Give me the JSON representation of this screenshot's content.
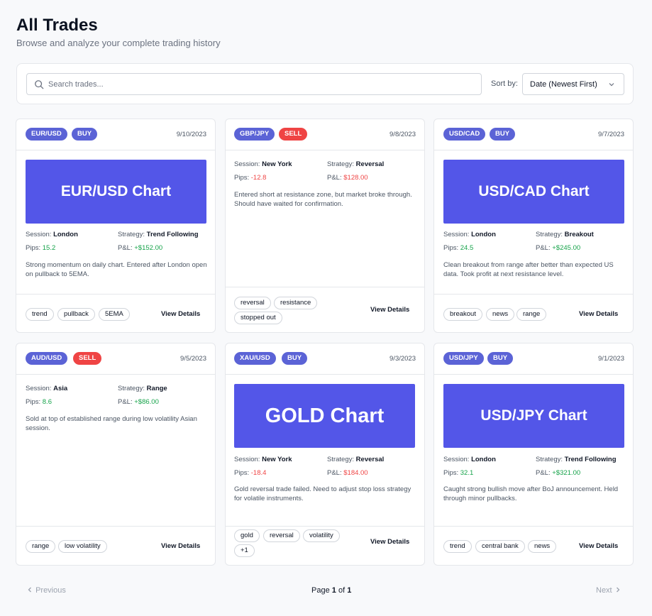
{
  "header": {
    "title": "All Trades",
    "subtitle": "Browse and analyze your complete trading history"
  },
  "filters": {
    "search_placeholder": "Search trades...",
    "sort_label": "Sort by:",
    "sort_value": "Date (Newest First)"
  },
  "labels": {
    "session": "Session:",
    "strategy": "Strategy:",
    "pips": "Pips:",
    "pnl": "P&L:",
    "view_details": "View Details"
  },
  "trades": [
    {
      "pair": "EUR/USD",
      "side": "BUY",
      "date": "9/10/2023",
      "chart_label": "EUR/USD Chart",
      "session": "London",
      "strategy": "Trend Following",
      "pips": "15.2",
      "pnl": "+$152.00",
      "note": "Strong momentum on daily chart. Entered after London open on pullback to 5EMA.",
      "tags": [
        "trend",
        "pullback",
        "5EMA"
      ]
    },
    {
      "pair": "GBP/JPY",
      "side": "SELL",
      "date": "9/8/2023",
      "session": "New York",
      "strategy": "Reversal",
      "pips": "-12.8",
      "pnl": "$128.00",
      "note": "Entered short at resistance zone, but market broke through. Should have waited for confirmation.",
      "tags": [
        "reversal",
        "resistance",
        "stopped out"
      ]
    },
    {
      "pair": "USD/CAD",
      "side": "BUY",
      "date": "9/7/2023",
      "chart_label": "USD/CAD Chart",
      "session": "London",
      "strategy": "Breakout",
      "pips": "24.5",
      "pnl": "+$245.00",
      "note": "Clean breakout from range after better than expected US data. Took profit at next resistance level.",
      "tags": [
        "breakout",
        "news",
        "range"
      ]
    },
    {
      "pair": "AUD/USD",
      "side": "SELL",
      "date": "9/5/2023",
      "session": "Asia",
      "strategy": "Range",
      "pips": "8.6",
      "pnl": "+$86.00",
      "note": "Sold at top of established range during low volatility Asian session.",
      "tags": [
        "range",
        "low volatility"
      ]
    },
    {
      "pair": "XAU/USD",
      "side": "BUY",
      "date": "9/3/2023",
      "chart_label": "GOLD Chart",
      "session": "New York",
      "strategy": "Reversal",
      "pips": "-18.4",
      "pnl": "$184.00",
      "note": "Gold reversal trade failed. Need to adjust stop loss strategy for volatile instruments.",
      "tags": [
        "gold",
        "reversal",
        "volatility",
        "+1"
      ]
    },
    {
      "pair": "USD/JPY",
      "side": "BUY",
      "date": "9/1/2023",
      "chart_label": "USD/JPY Chart",
      "session": "London",
      "strategy": "Trend Following",
      "pips": "32.1",
      "pnl": "+$321.00",
      "note": "Caught strong bullish move after BoJ announcement. Held through minor pullbacks.",
      "tags": [
        "trend",
        "central bank",
        "news"
      ]
    }
  ],
  "pagination": {
    "prev_label": "Previous",
    "next_label": "Next",
    "page_word": "Page",
    "of_word": "of",
    "current": "1",
    "total": "1"
  },
  "colors": {
    "accent": "#5356e8",
    "badge_blue": "#5b63d6",
    "sell_red": "#ef4444",
    "profit_green": "#16a34a",
    "loss_red": "#ef4444"
  },
  "icons": {
    "search": "search-icon",
    "sort": "chevron-down-icon",
    "prev": "chevron-left-icon",
    "next": "chevron-right-icon"
  }
}
